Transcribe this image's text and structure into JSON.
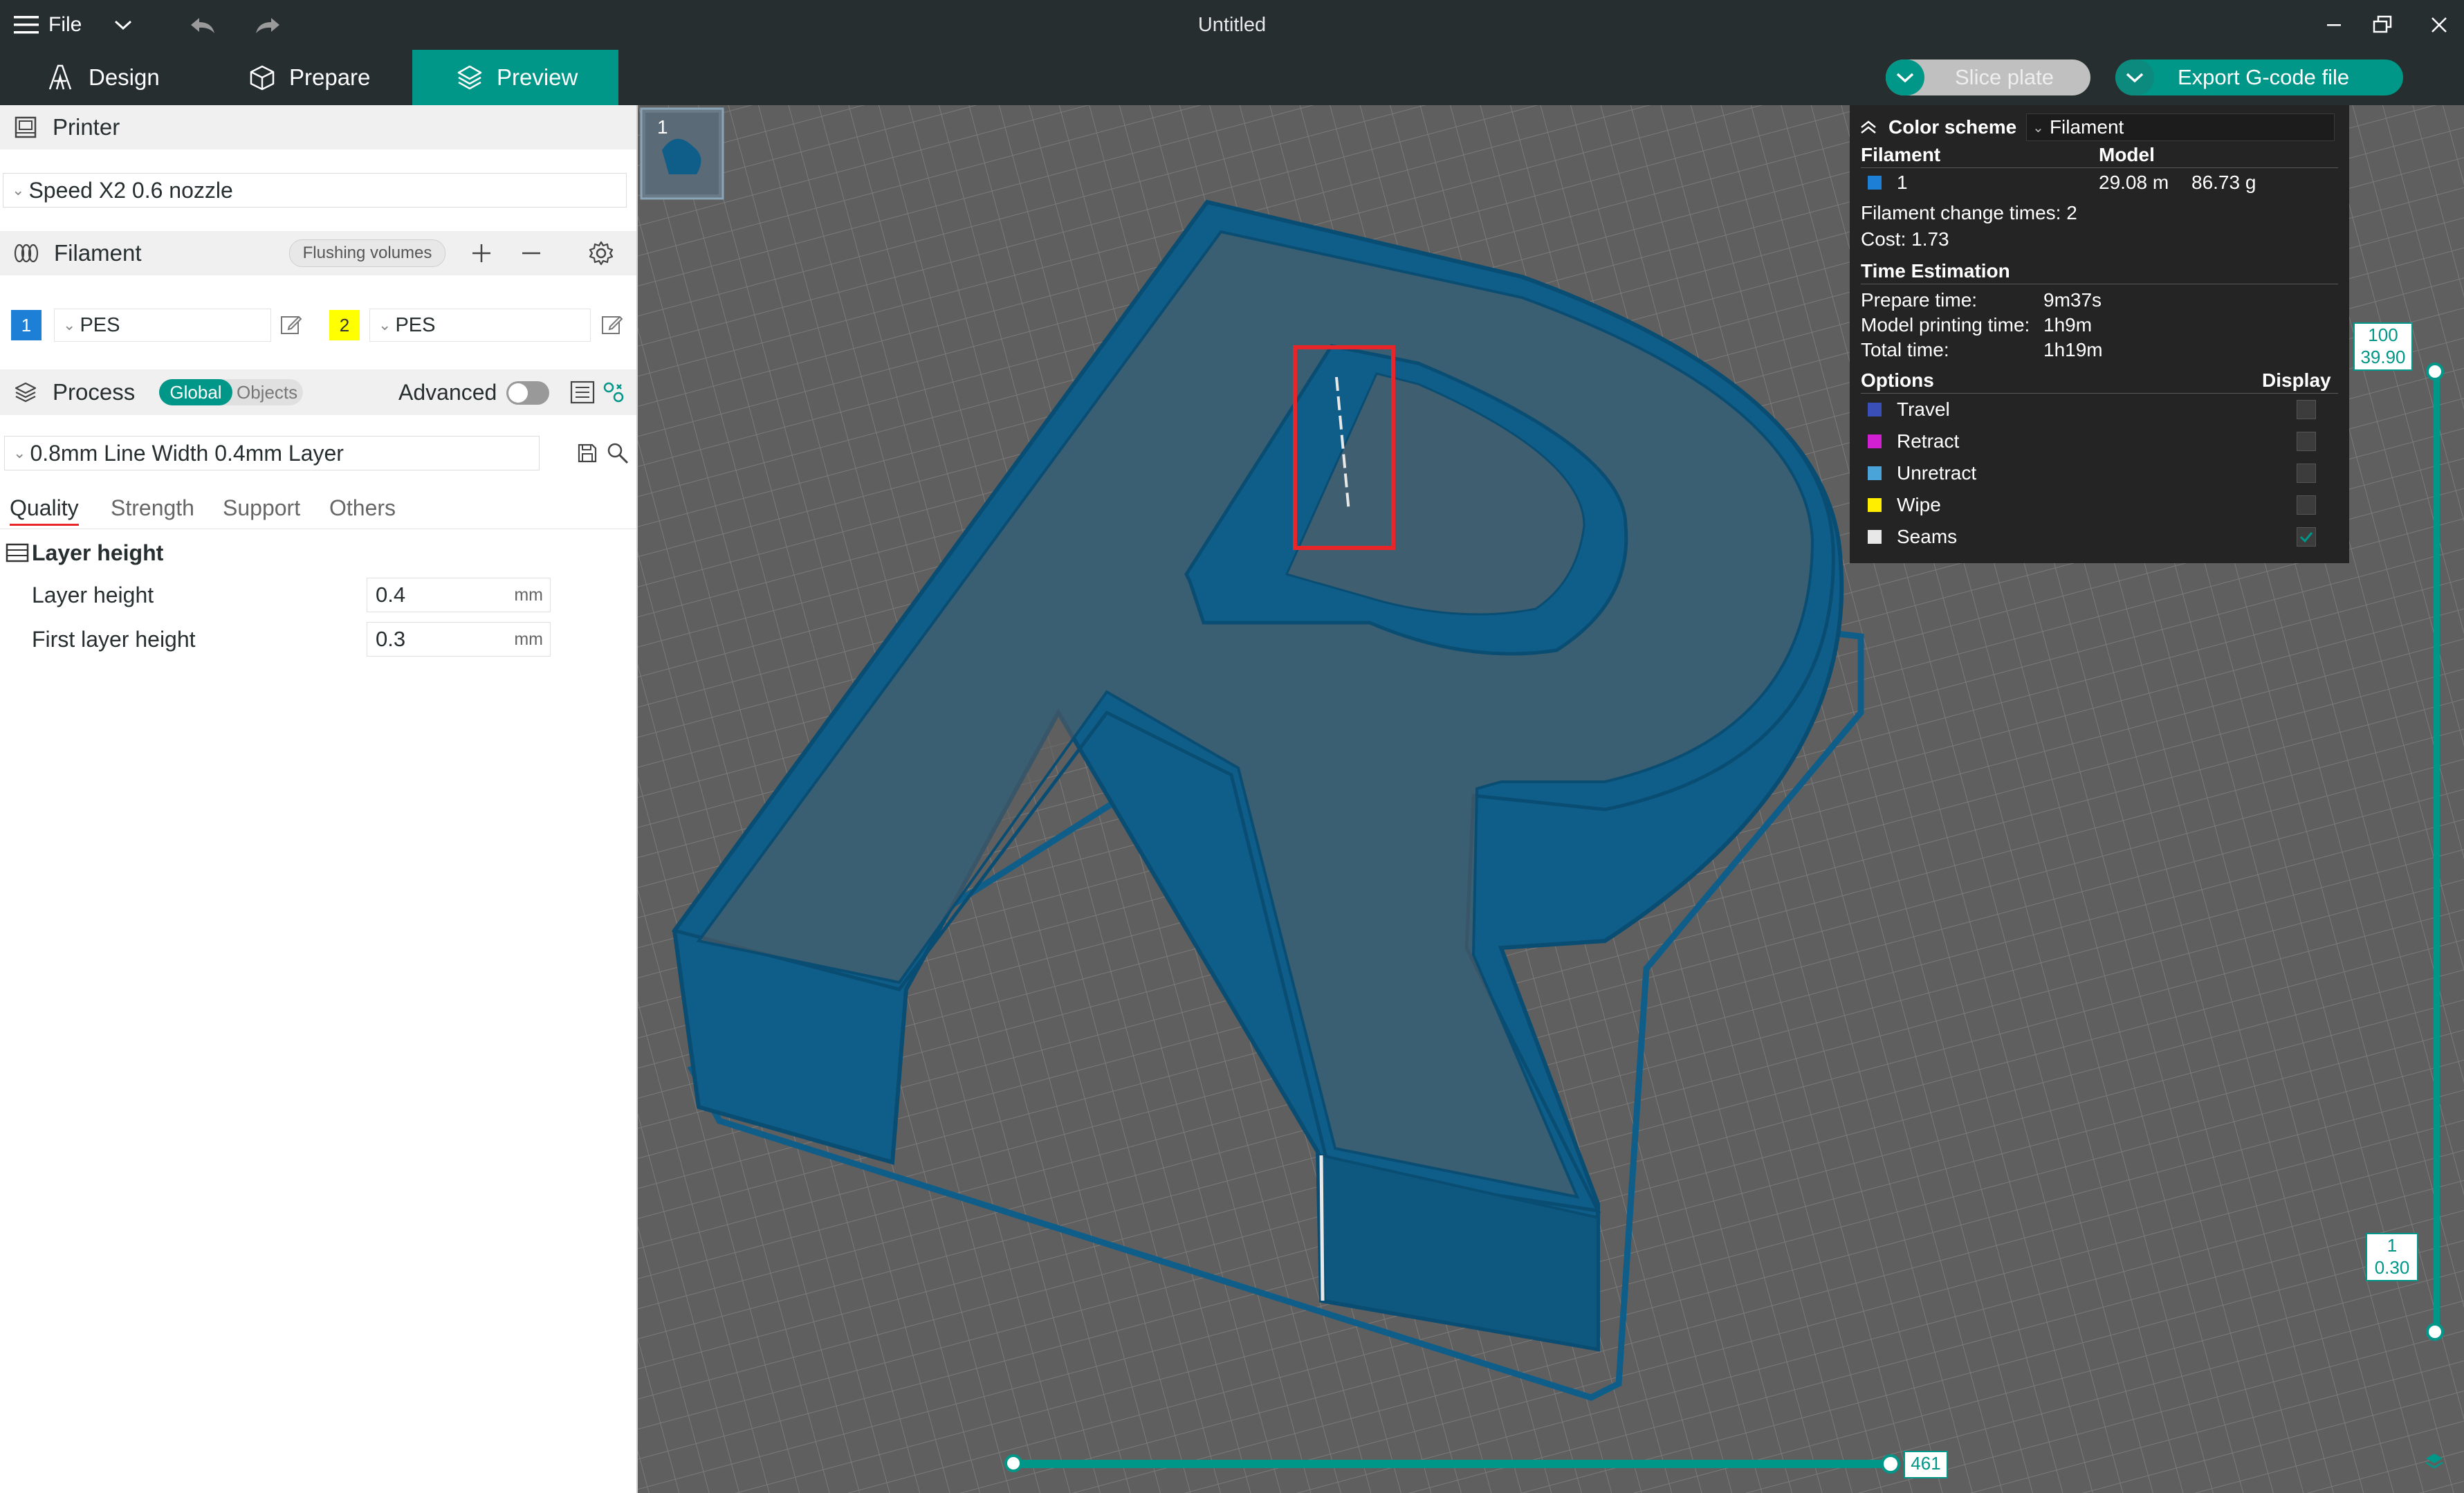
{
  "window": {
    "title": "Untitled",
    "file_menu_label": "File"
  },
  "nav": {
    "tabs": [
      {
        "label": "Design"
      },
      {
        "label": "Prepare"
      },
      {
        "label": "Preview"
      }
    ],
    "slice_label": "Slice plate",
    "export_label": "Export G-code file"
  },
  "printer": {
    "section_label": "Printer",
    "selected": "Speed X2 0.6 nozzle"
  },
  "filament": {
    "section_label": "Filament",
    "flushing_label": "Flushing volumes",
    "slots": [
      {
        "index": "1",
        "type": "PES",
        "color": "#1e7fd6"
      },
      {
        "index": "2",
        "type": "PES",
        "color": "#ffff00"
      }
    ]
  },
  "process": {
    "section_label": "Process",
    "global_label": "Global",
    "objects_label": "Objects",
    "advanced_label": "Advanced",
    "preset": "0.8mm Line Width 0.4mm Layer",
    "tabs": [
      "Quality",
      "Strength",
      "Support",
      "Others"
    ],
    "group_title": "Layer height",
    "fields": [
      {
        "label": "Layer height",
        "value": "0.4",
        "unit": "mm"
      },
      {
        "label": "First layer height",
        "value": "0.3",
        "unit": "mm"
      }
    ]
  },
  "plate": {
    "number": "1"
  },
  "legend": {
    "color_scheme_label": "Color scheme",
    "color_scheme_value": "Filament",
    "filament_header": "Filament",
    "model_header": "Model",
    "filament_row": {
      "index": "1",
      "length": "29.08 m",
      "weight": "86.73 g",
      "color": "#1e7fd6"
    },
    "change_times": "Filament change times: 2",
    "cost": "Cost: 1.73",
    "time_header": "Time Estimation",
    "times": [
      {
        "label": "Prepare time:",
        "value": "9m37s"
      },
      {
        "label": "Model printing time:",
        "value": "1h9m"
      },
      {
        "label": "Total time:",
        "value": "1h19m"
      }
    ],
    "options_header": "Options",
    "display_header": "Display",
    "options": [
      {
        "label": "Travel",
        "color": "#3a4fb8",
        "checked": false
      },
      {
        "label": "Retract",
        "color": "#d21fd2",
        "checked": false
      },
      {
        "label": "Unretract",
        "color": "#4aa3d9",
        "checked": false
      },
      {
        "label": "Wipe",
        "color": "#ffee00",
        "checked": false
      },
      {
        "label": "Seams",
        "color": "#e8e8e8",
        "checked": true
      }
    ]
  },
  "layer_slider": {
    "top_layer": "100",
    "top_height": "39.90",
    "bottom_layer": "1",
    "bottom_height": "0.30"
  },
  "move_slider": {
    "value": "461"
  },
  "colors": {
    "accent": "#009688",
    "model": "#0f5e8a",
    "highlight": "#e8262a"
  }
}
